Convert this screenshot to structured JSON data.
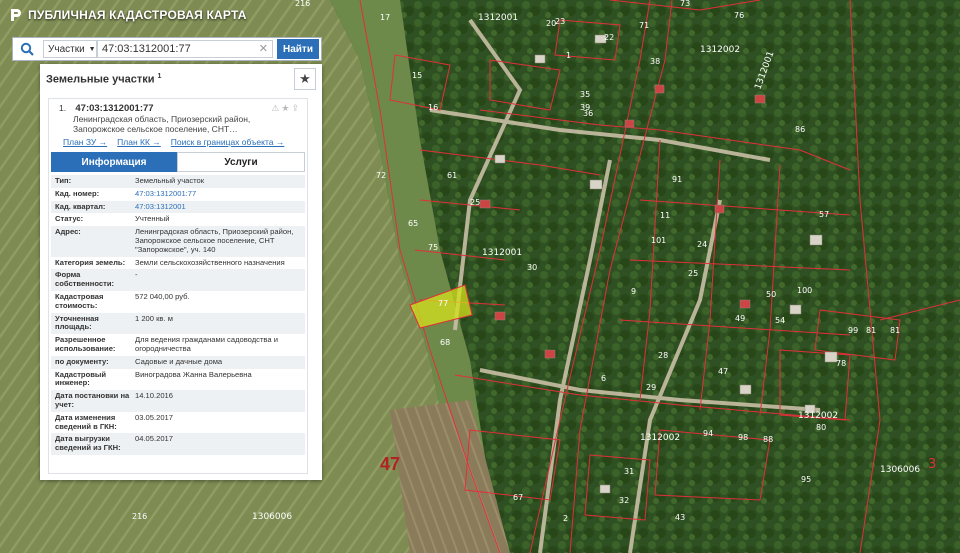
{
  "app": {
    "title": "ПУБЛИЧНАЯ КАДАСТРОВАЯ КАРТА"
  },
  "search": {
    "mode": "Участки",
    "value": "47:03:1312001:77",
    "button": "Найти"
  },
  "panel": {
    "title": "Земельные участки",
    "count": "1",
    "card": {
      "index": "1.",
      "cad_number": "47:03:1312001:77",
      "address_line1": "Ленинградская область, Приозерский район,",
      "address_line2": "Запорожское сельское поселение, СНТ…",
      "links": [
        "План ЗУ →",
        "План КК →",
        "Поиск в границах объекта →"
      ],
      "tabs": [
        "Информация",
        "Услуги"
      ],
      "rows": [
        {
          "k": "Тип:",
          "v": "Земельный участок"
        },
        {
          "k": "Кад. номер:",
          "v": "47:03:1312001:77"
        },
        {
          "k": "Кад. квартал:",
          "v": "47:03:1312001"
        },
        {
          "k": "Статус:",
          "v": "Учтенный"
        },
        {
          "k": "Адрес:",
          "v": "Ленинградская область, Приозерский район, Запорожское сельское поселение, СНТ \"Запорожское\", уч. 140"
        },
        {
          "k": "Категория земель:",
          "v": "Земли сельскохозяйственного назначения"
        },
        {
          "k": "Форма собственности:",
          "v": "-"
        },
        {
          "k": "Кадастровая стоимость:",
          "v": "572 040,00 руб."
        },
        {
          "k": "Уточненная площадь:",
          "v": "1 200 кв. м"
        },
        {
          "k": "Разрешенное использование:",
          "v": "Для ведения гражданами садоводства и огородничества"
        },
        {
          "k": "по документу:",
          "v": "Садовые и дачные дома"
        },
        {
          "k": "Кадастровый инженер:",
          "v": "Виноградова Жанна Валерьевна"
        },
        {
          "k": "Дата постановки на учет:",
          "v": "14.10.2016"
        },
        {
          "k": "Дата изменения сведений в ГКН:",
          "v": "03.05.2017"
        },
        {
          "k": "Дата выгрузки сведений из ГКН:",
          "v": "04.05.2017"
        }
      ]
    }
  },
  "map": {
    "district_label": "47",
    "quarter_labels": [
      "1312001",
      "1312001",
      "1312002",
      "1312002",
      "1312002",
      "1312001",
      "1306006",
      "1306006",
      "3"
    ],
    "parcel_labels": [
      "216",
      "17",
      "73",
      "20",
      "22",
      "23",
      "1",
      "71",
      "38",
      "76",
      "39",
      "15",
      "16",
      "35",
      "36",
      "72",
      "61",
      "25",
      "65",
      "75",
      "77",
      "68",
      "81",
      "91",
      "11",
      "101",
      "24",
      "25",
      "9",
      "30",
      "28",
      "6",
      "29",
      "47",
      "57",
      "100",
      "50",
      "49",
      "54",
      "86",
      "99",
      "81",
      "78",
      "80",
      "94",
      "98",
      "88",
      "95",
      "31",
      "32",
      "43",
      "2",
      "67",
      "216"
    ],
    "colors": {
      "boundary": "#e0303a",
      "selected": "#d6e01c"
    }
  }
}
